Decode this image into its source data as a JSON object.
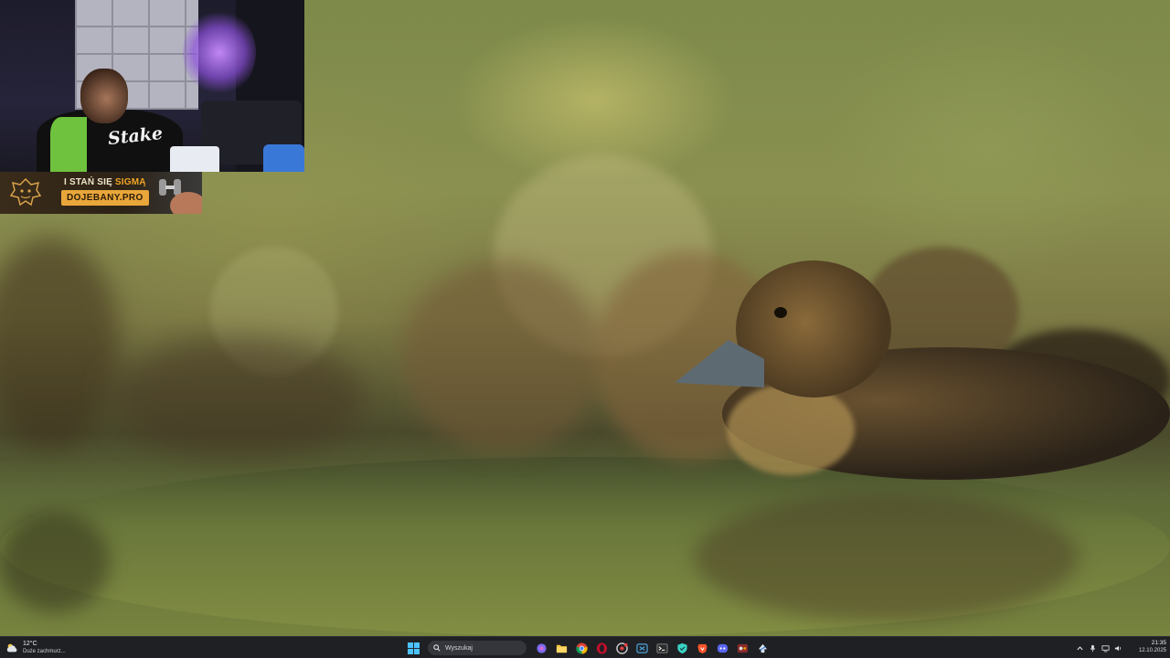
{
  "desktop": {
    "wallpaper": "ducklings-on-water-photo"
  },
  "stream_overlay": {
    "webcam": {
      "jersey_text": "Stake"
    },
    "sponsor": {
      "tagline_prefix": "I STAŃ SIĘ ",
      "tagline_accent": "SIGMĄ",
      "url": "DOJEBANY.PRO",
      "colors": {
        "accent": "#f0a624",
        "url_bg": "#e9a63a"
      }
    }
  },
  "taskbar": {
    "weather": {
      "temperature": "12°C",
      "condition": "Duże zachmurz..."
    },
    "search": {
      "placeholder": "Wyszukaj"
    },
    "apps": [
      "windows-start-icon",
      "search-box",
      "copilot-icon",
      "file-explorer-icon",
      "chrome-icon",
      "opera-icon",
      "chrome-beta-icon",
      "app-icon",
      "terminal-icon",
      "vpn-shield-icon",
      "brave-icon",
      "discord-icon",
      "media-icon",
      "steam-icon"
    ],
    "tray": {
      "icons": [
        "chevron-up-icon",
        "microphone-icon",
        "network-icon",
        "volume-icon"
      ]
    },
    "clock": {
      "time": "21:35",
      "date": "12.10.2025"
    }
  }
}
